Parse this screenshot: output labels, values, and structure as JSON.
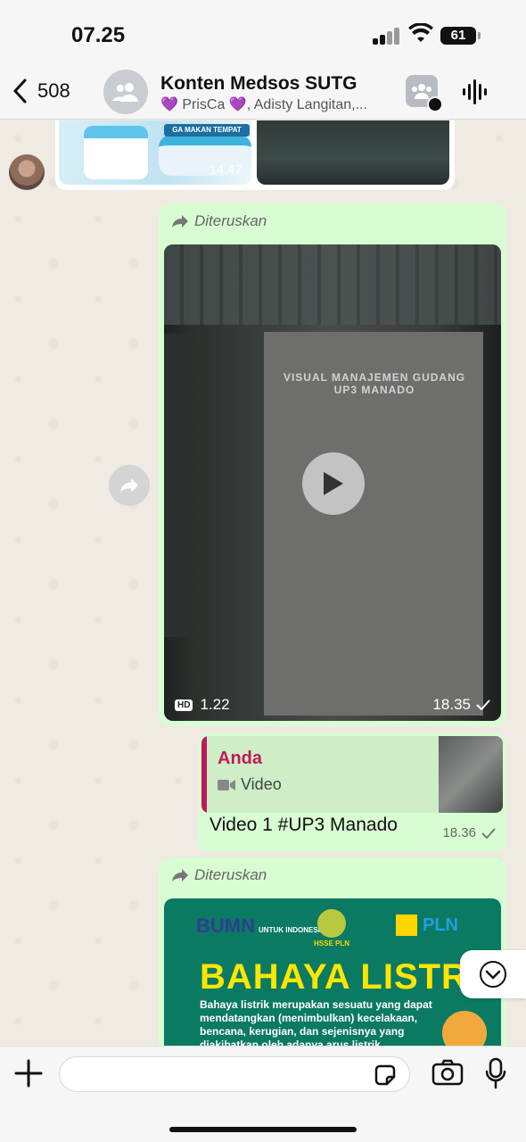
{
  "status": {
    "time": "07.25",
    "battery": "61"
  },
  "header": {
    "back_count": "508",
    "title": "Konten Medsos SUTG",
    "subtitle": "💜 PrisCa 💜, Adisty Langitan,..."
  },
  "messages": {
    "prev_media": {
      "tag": "GA MAKAN TEMPAT",
      "time": "14.47"
    },
    "forwarded_video": {
      "forwarded_label": "Diteruskan",
      "poster_title": "VISUAL MANAJEMEN GUDANG UP3 MANADO",
      "quality_badge": "HD",
      "duration": "1.22",
      "time": "18.35"
    },
    "reply": {
      "quoted_name": "Anda",
      "quoted_type": "Video",
      "text": "Video 1 #UP3 Manado",
      "time": "18.36"
    },
    "forwarded_image": {
      "forwarded_label": "Diteruskan",
      "bumn": "BUMN",
      "bumn_sub": "UNTUK INDONESIA",
      "hsse": "HSSE PLN",
      "pln": "PLN",
      "title": "BAHAYA LISTRIK",
      "body": "Bahaya listrik merupakan sesuatu yang dapat mendatangkan (menimbulkan) kecelakaan, bencana, kerugian, dan sejenisnya yang diakibatkan oleh adanya arus listrik"
    }
  },
  "composer": {
    "placeholder": ""
  },
  "colors": {
    "bubble_out": "#d9fdd3",
    "chat_bg": "#efeae2",
    "quote_accent": "#c2185b"
  }
}
